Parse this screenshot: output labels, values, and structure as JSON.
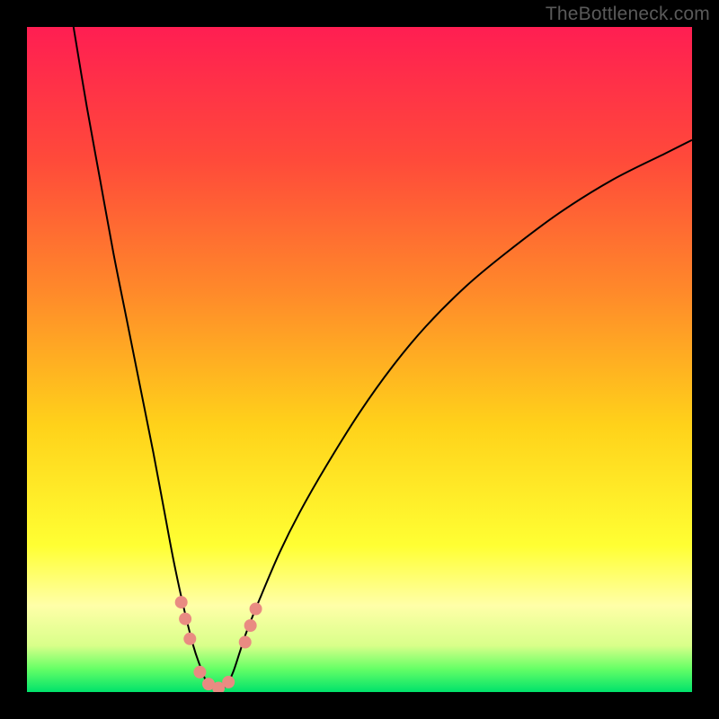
{
  "watermark": "TheBottleneck.com",
  "chart_data": {
    "type": "line",
    "title": "",
    "xlabel": "",
    "ylabel": "",
    "xlim": [
      0,
      100
    ],
    "ylim": [
      0,
      100
    ],
    "grid": false,
    "legend": false,
    "background_gradient": {
      "stops": [
        {
          "offset": 0.0,
          "color": "#ff1e52"
        },
        {
          "offset": 0.2,
          "color": "#ff4a3a"
        },
        {
          "offset": 0.4,
          "color": "#ff8a2a"
        },
        {
          "offset": 0.6,
          "color": "#ffd21a"
        },
        {
          "offset": 0.78,
          "color": "#ffff33"
        },
        {
          "offset": 0.87,
          "color": "#ffffa8"
        },
        {
          "offset": 0.93,
          "color": "#d9ff8a"
        },
        {
          "offset": 0.965,
          "color": "#66ff66"
        },
        {
          "offset": 1.0,
          "color": "#00e26b"
        }
      ]
    },
    "series": [
      {
        "name": "bottleneck-curve",
        "color": "#000000",
        "stroke_width": 2,
        "x": [
          7,
          9,
          11,
          13,
          15,
          17,
          19,
          20.5,
          22,
          23.5,
          25,
          26,
          27,
          28,
          29,
          30,
          31,
          32,
          33,
          35,
          38,
          41,
          45,
          50,
          55,
          60,
          66,
          72,
          80,
          88,
          96,
          100
        ],
        "y": [
          100,
          88,
          77,
          66,
          56,
          46,
          36,
          28,
          20,
          13,
          7,
          4,
          1.5,
          0.5,
          0.5,
          1,
          3,
          6,
          9,
          14,
          21,
          27,
          34,
          42,
          49,
          55,
          61,
          66,
          72,
          77,
          81,
          83
        ]
      }
    ],
    "markers": [
      {
        "name": "highlight-dots",
        "color": "#e98b82",
        "radius": 7,
        "points": [
          {
            "x": 23.2,
            "y": 13.5
          },
          {
            "x": 23.8,
            "y": 11.0
          },
          {
            "x": 24.5,
            "y": 8.0
          },
          {
            "x": 26.0,
            "y": 3.0
          },
          {
            "x": 27.3,
            "y": 1.2
          },
          {
            "x": 28.8,
            "y": 0.6
          },
          {
            "x": 30.3,
            "y": 1.5
          },
          {
            "x": 32.8,
            "y": 7.5
          },
          {
            "x": 33.6,
            "y": 10.0
          },
          {
            "x": 34.4,
            "y": 12.5
          }
        ]
      }
    ]
  }
}
